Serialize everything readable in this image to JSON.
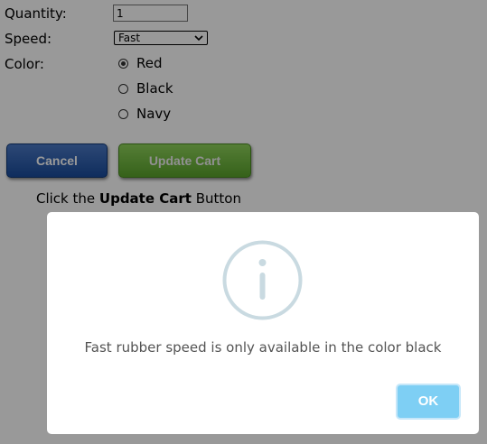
{
  "form": {
    "quantity_label": "Quantity:",
    "quantity_value": "1",
    "speed_label": "Speed:",
    "speed_selected": "Fast",
    "color_label": "Color:",
    "color_options": [
      {
        "label": "Red",
        "checked": true
      },
      {
        "label": "Black",
        "checked": false
      },
      {
        "label": "Navy",
        "checked": false
      }
    ]
  },
  "buttons": {
    "cancel_label": "Cancel",
    "update_label": "Update Cart"
  },
  "instruction": {
    "prefix": "Click the ",
    "bold": "Update Cart",
    "suffix": " Button"
  },
  "modal": {
    "icon": "info-icon",
    "message": "Fast rubber speed is only available in the color black",
    "ok_label": "OK"
  },
  "colors": {
    "cancel_button": "#1a4c9c",
    "update_button": "#5aa32c",
    "ok_button": "#7ecff4",
    "info_icon": "#c9dae1",
    "overlay": "rgba(0,0,0,0.4)"
  }
}
